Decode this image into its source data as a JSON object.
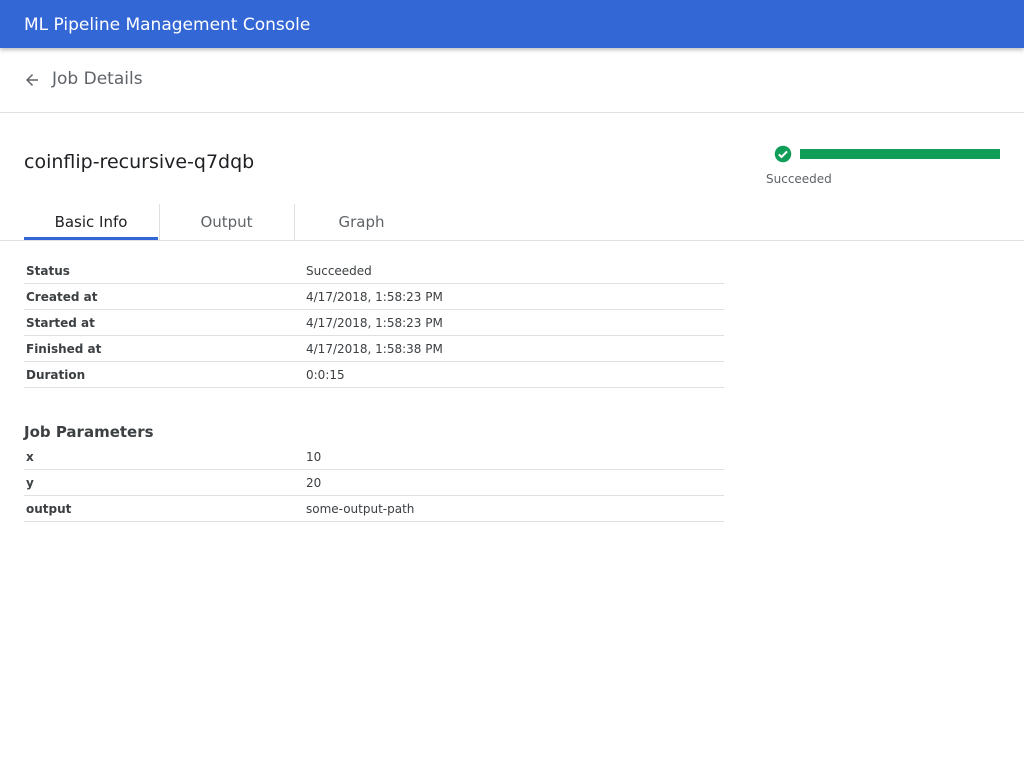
{
  "app": {
    "title": "ML Pipeline Management Console"
  },
  "header": {
    "page_title": "Job Details",
    "back_icon": "arrow-back-icon"
  },
  "job": {
    "name": "coinflip-recursive-q7dqb"
  },
  "status": {
    "label": "Succeeded",
    "icon": "check-circle-icon",
    "progress_percent": 100,
    "color": "#0f9d58"
  },
  "tabs": [
    {
      "label": "Basic Info",
      "active": true
    },
    {
      "label": "Output",
      "active": false
    },
    {
      "label": "Graph",
      "active": false
    }
  ],
  "basic_info": [
    {
      "key": "Status",
      "value": "Succeeded"
    },
    {
      "key": "Created at",
      "value": "4/17/2018, 1:58:23 PM"
    },
    {
      "key": "Started at",
      "value": "4/17/2018, 1:58:23 PM"
    },
    {
      "key": "Finished at",
      "value": "4/17/2018, 1:58:38 PM"
    },
    {
      "key": "Duration",
      "value": "0:0:15"
    }
  ],
  "parameters": {
    "title": "Job Parameters",
    "rows": [
      {
        "key": "x",
        "value": "10"
      },
      {
        "key": "y",
        "value": "20"
      },
      {
        "key": "output",
        "value": "some-output-path"
      }
    ]
  },
  "colors": {
    "primary": "#3367d6",
    "success": "#0f9d58"
  }
}
